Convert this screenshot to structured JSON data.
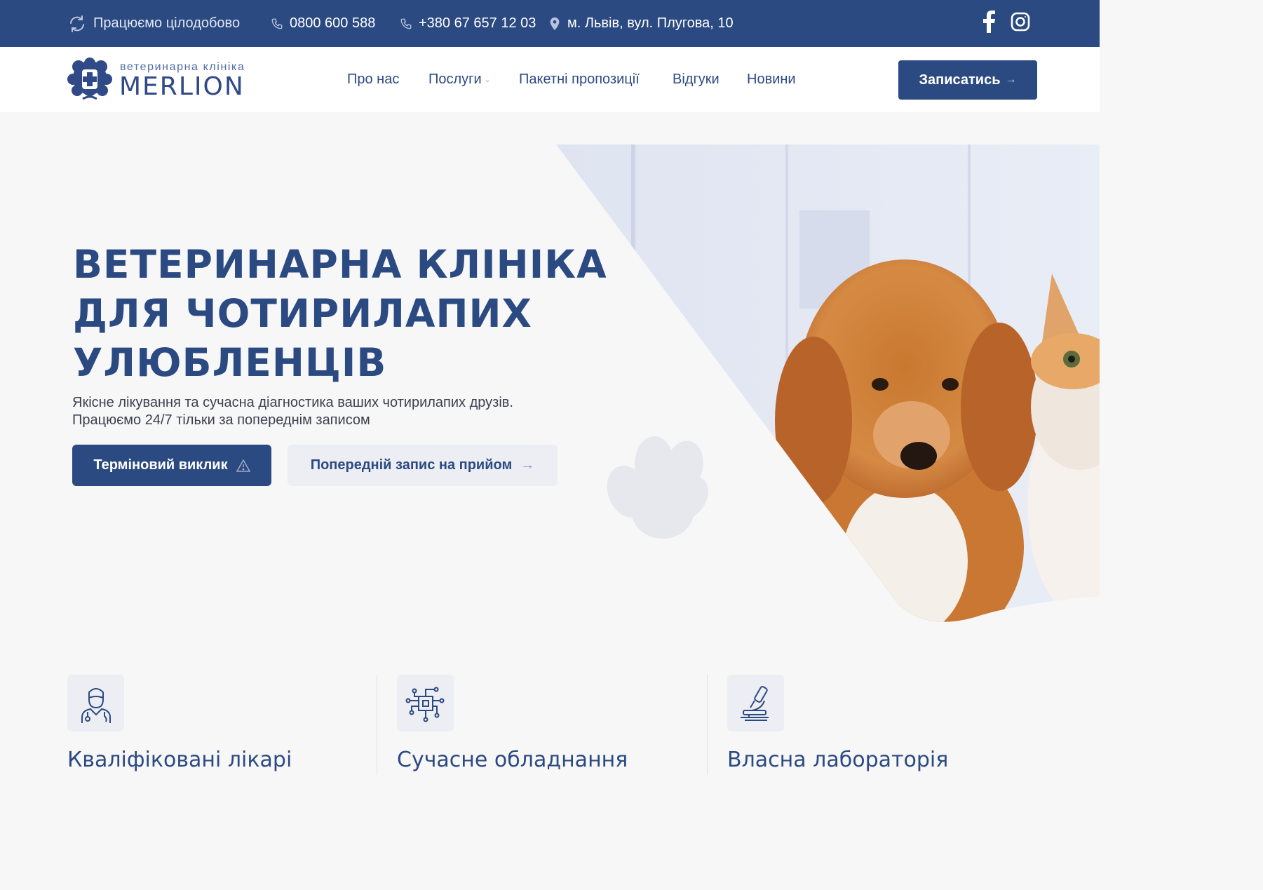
{
  "topbar": {
    "hours": "Працюємо цілодобово",
    "phone1": "0800 600 588",
    "phone2": "+380 67 657 12 03",
    "address": "м. Львів, вул. Плугова, 10",
    "social": [
      "facebook-icon",
      "instagram-icon"
    ]
  },
  "header": {
    "logo_subtitle": "ветеринарна клініка",
    "logo_name": "MERLION",
    "nav": [
      "Про нас",
      "Послуги",
      "Пакетні пропозиції",
      "Відгуки",
      "Новини"
    ],
    "signup_label": "Записатись"
  },
  "hero": {
    "title_lines": [
      "ВЕТЕРИНАРНА КЛІНІКА",
      "ДЛЯ ЧОТИРИЛАПИХ",
      "УЛЮБЛЕНЦІВ"
    ],
    "subtitle_lines": [
      "Якісне лікування та сучасна діагностика ваших чотирилапих друзів.",
      "Працюємо 24/7 тільки за попереднім записом"
    ],
    "urgent_label": "Терміновий виклик",
    "booking_label": "Попередній запис на прийом"
  },
  "features": [
    {
      "title": "Кваліфіковані лікарі",
      "icon": "doctor-icon"
    },
    {
      "title": "Сучасне обладнання",
      "icon": "circuit-chip-icon"
    },
    {
      "title": "Власна лабораторія",
      "icon": "microscope-icon"
    }
  ],
  "colors": {
    "primary": "#2c4a82",
    "background": "#f7f7f8",
    "light_button": "#eceef4",
    "white": "#ffffff"
  }
}
